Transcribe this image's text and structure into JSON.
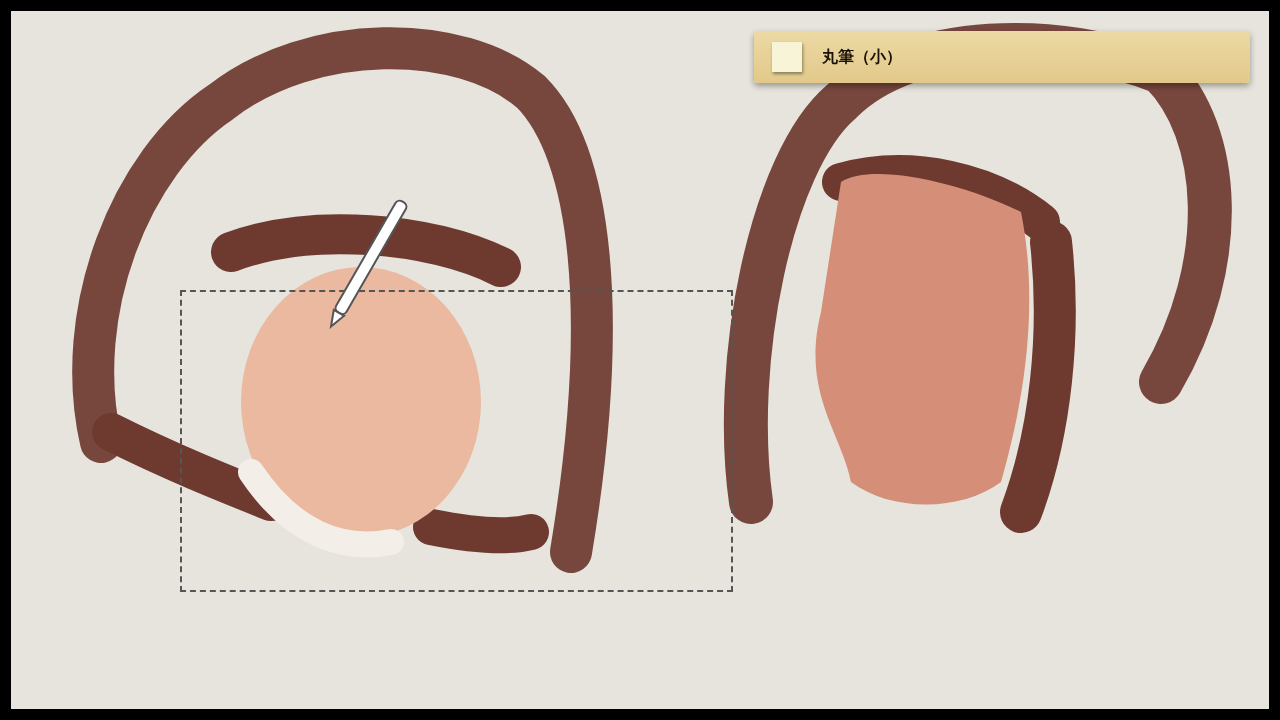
{
  "tool_panel": {
    "brush_name": "丸筆（小）"
  }
}
